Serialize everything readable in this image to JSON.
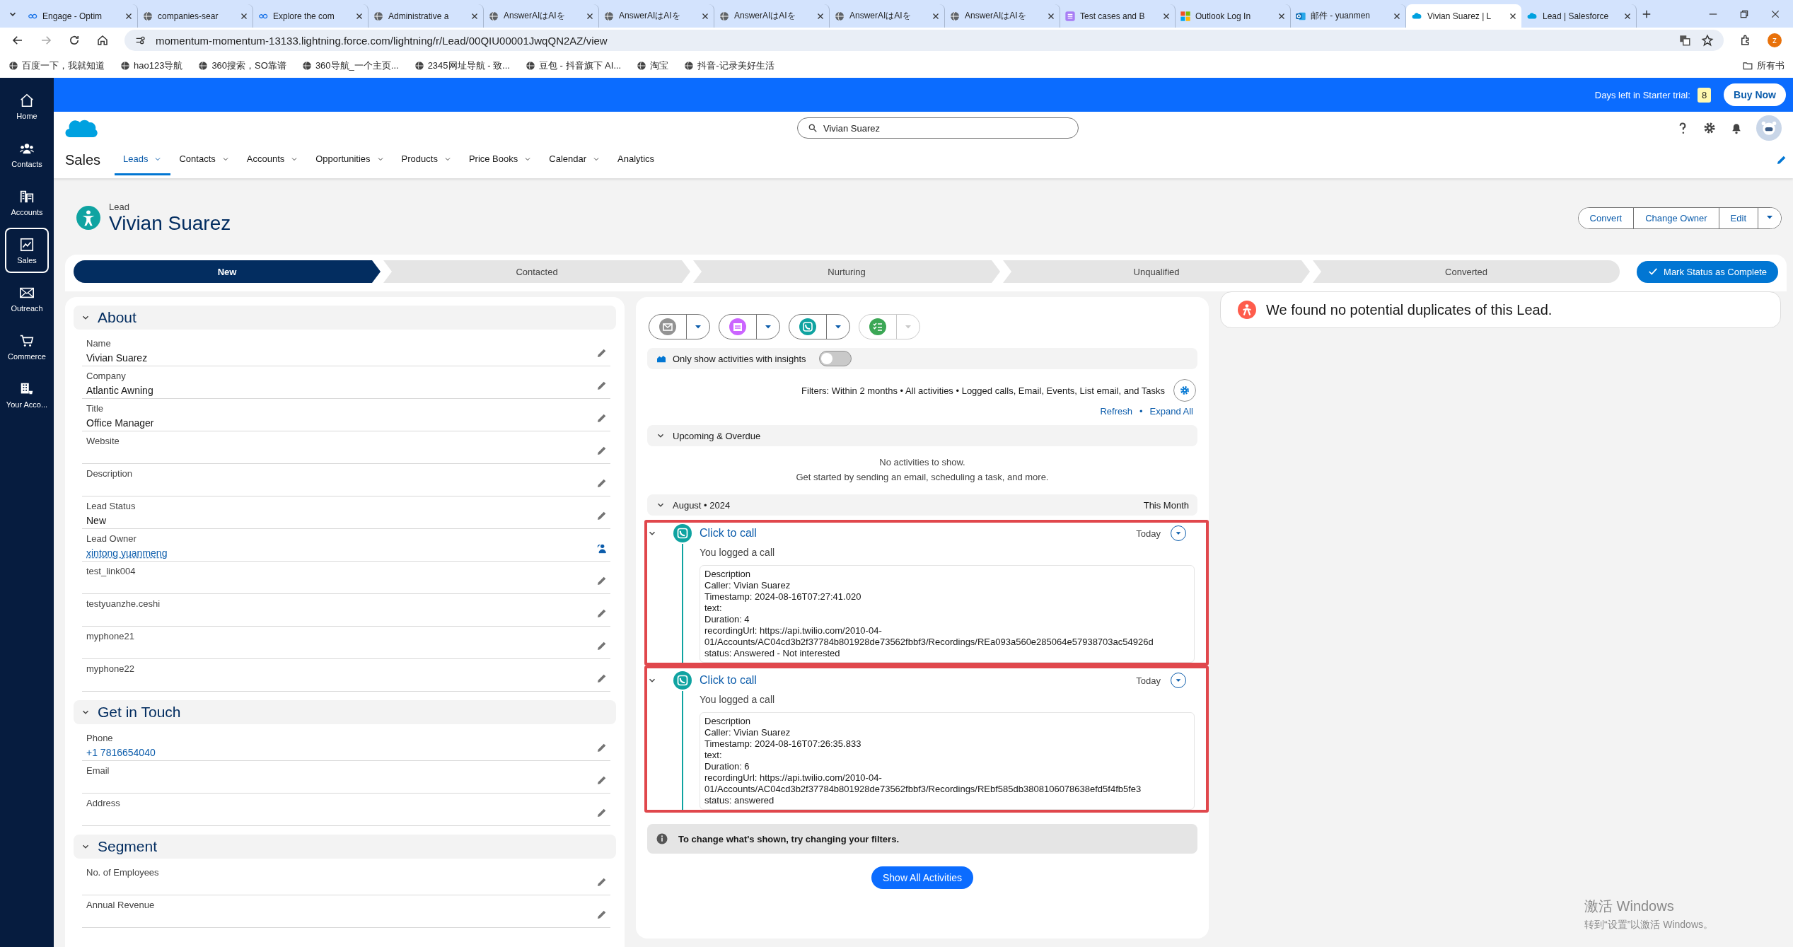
{
  "browser": {
    "tabs": [
      {
        "title": "Engage - Optim",
        "selected": false
      },
      {
        "title": "companies-sear",
        "selected": false
      },
      {
        "title": "Explore the com",
        "selected": false
      },
      {
        "title": "Administrative a",
        "selected": false
      },
      {
        "title": "AnswerAIはAIを",
        "selected": false
      },
      {
        "title": "AnswerAIはAIを",
        "selected": false
      },
      {
        "title": "AnswerAIはAIを",
        "selected": false
      },
      {
        "title": "AnswerAIはAIを",
        "selected": false
      },
      {
        "title": "AnswerAIはAIを",
        "selected": false
      },
      {
        "title": "Test cases and B",
        "selected": false
      },
      {
        "title": "Outlook Log In",
        "selected": false
      },
      {
        "title": "邮件 - yuanmen",
        "selected": false
      },
      {
        "title": "Vivian Suarez | L",
        "selected": true
      },
      {
        "title": "Lead | Salesforce",
        "selected": false
      }
    ],
    "url": "momentum-momentum-13133.lightning.force.com/lightning/r/Lead/00QIU00001JwqQN2AZ/view",
    "profile": "z",
    "bookmarks": [
      "百度一下，我就知道",
      "hao123导航",
      "360搜索，SO靠谱",
      "360导航_一个主页...",
      "2345网址导航 - 致...",
      "豆包 - 抖音旗下 AI...",
      "淘宝",
      "抖音-记录美好生活"
    ],
    "all_bookmarks": "所有书"
  },
  "sidebar": {
    "items": [
      {
        "label": "Home",
        "selected": false
      },
      {
        "label": "Contacts",
        "selected": false
      },
      {
        "label": "Accounts",
        "selected": false
      },
      {
        "label": "Sales",
        "selected": true
      },
      {
        "label": "Outreach",
        "selected": false
      },
      {
        "label": "Commerce",
        "selected": false
      },
      {
        "label": "Your Acco...",
        "selected": false
      }
    ]
  },
  "trial_bar": {
    "text": "Days left in Starter trial:",
    "days": "8",
    "button": "Buy Now"
  },
  "header": {
    "app_name": "Sales",
    "search": {
      "value": "Vivian Suarez"
    },
    "nav": [
      {
        "label": "Leads",
        "selected": true,
        "menu": true
      },
      {
        "label": "Contacts",
        "selected": false,
        "menu": true
      },
      {
        "label": "Accounts",
        "selected": false,
        "menu": true
      },
      {
        "label": "Opportunities",
        "selected": false,
        "menu": true
      },
      {
        "label": "Products",
        "selected": false,
        "menu": true
      },
      {
        "label": "Price Books",
        "selected": false,
        "menu": true
      },
      {
        "label": "Calendar",
        "selected": false,
        "menu": true
      },
      {
        "label": "Analytics",
        "selected": false,
        "menu": false
      }
    ]
  },
  "record": {
    "type": "Lead",
    "name": "Vivian Suarez",
    "actions": [
      "Convert",
      "Change Owner",
      "Edit"
    ]
  },
  "path": {
    "stages": [
      {
        "label": "New",
        "selected": true
      },
      {
        "label": "Contacted",
        "selected": false
      },
      {
        "label": "Nurturing",
        "selected": false
      },
      {
        "label": "Unqualified",
        "selected": false
      },
      {
        "label": "Converted",
        "selected": false
      }
    ],
    "button": "Mark Status as Complete"
  },
  "details": {
    "sections": [
      {
        "title": "About",
        "expanded": true,
        "fields": [
          {
            "label": "Name",
            "value": "Vivian Suarez",
            "kind": "text"
          },
          {
            "label": "Company",
            "value": "Atlantic Awning",
            "kind": "text"
          },
          {
            "label": "Title",
            "value": "Office Manager",
            "kind": "text"
          },
          {
            "label": "Website",
            "kind": "text"
          },
          {
            "label": "Description",
            "kind": "text"
          },
          {
            "label": "Lead Status",
            "value": "New",
            "kind": "text"
          },
          {
            "label": "Lead Owner",
            "value": "xintong yuanmeng",
            "kind": "owner"
          },
          {
            "label": "test_link004",
            "kind": "text"
          },
          {
            "label": "testyuanzhe.ceshi",
            "kind": "text"
          },
          {
            "label": "myphone21",
            "kind": "text"
          },
          {
            "label": "myphone22",
            "kind": "text"
          }
        ]
      },
      {
        "title": "Get in Touch",
        "expanded": true,
        "fields": [
          {
            "label": "Phone",
            "value": "+1 7816654040",
            "kind": "link"
          },
          {
            "label": "Email",
            "kind": "text"
          },
          {
            "label": "Address",
            "kind": "text"
          }
        ]
      },
      {
        "title": "Segment",
        "expanded": true,
        "fields": [
          {
            "label": "No. of Employees",
            "kind": "text"
          },
          {
            "label": "Annual Revenue",
            "kind": "text"
          }
        ]
      }
    ]
  },
  "activity": {
    "composer": [
      {
        "menu_disabled": false
      },
      {
        "menu_disabled": false
      },
      {
        "menu_disabled": false
      },
      {
        "menu_disabled": true
      }
    ],
    "insights": {
      "label": "Only show activities with insights",
      "on": false
    },
    "filters": "Filters: Within 2 months • All activities • Logged calls, Email, Events, List email, and Tasks",
    "links": [
      "Refresh",
      "Expand All"
    ],
    "link_separator": "•",
    "upcoming": {
      "title": "Upcoming & Overdue",
      "expanded": true,
      "empty": [
        "No activities to show.",
        "Get started by sending an email, scheduling a task, and more."
      ]
    },
    "month": {
      "title": "August • 2024",
      "note": "This Month"
    },
    "items": [
      {
        "title": "Click to call",
        "date": "Today",
        "summary": "You logged a call",
        "expanded": true,
        "highlighted": true,
        "description": [
          "Description",
          "Caller: Vivian Suarez",
          "Timestamp: 2024-08-16T07:27:41.020",
          "text:",
          "Duration: 4",
          "recordingUrl: https://api.twilio.com/2010-04-",
          "01/Accounts/AC04cd3b2f37784b801928de73562fbbf3/Recordings/REa093a560e285064e57938703ac54926d",
          "status: Answered - Not interested"
        ]
      },
      {
        "title": "Click to call",
        "date": "Today",
        "summary": "You logged a call",
        "expanded": true,
        "highlighted": true,
        "description": [
          "Description",
          "Caller: Vivian Suarez",
          "Timestamp: 2024-08-16T07:26:35.833",
          "text:",
          "Duration: 6",
          "recordingUrl: https://api.twilio.com/2010-04-",
          "01/Accounts/AC04cd3b2f37784b801928de73562fbbf3/Recordings/REbf585db3808106078638efd5f4fb5fe3",
          "status: answered"
        ]
      }
    ],
    "info": "To change what's shown, try changing your filters.",
    "show_all": "Show All Activities"
  },
  "duplicates": {
    "text": "We found no potential duplicates of this Lead."
  },
  "os_watermark": [
    "激活 Windows",
    "转到“设置”以激活 Windows。"
  ]
}
